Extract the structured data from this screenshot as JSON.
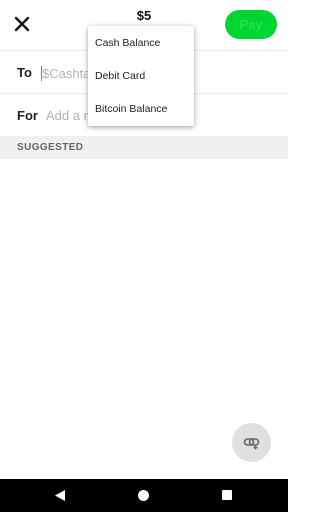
{
  "header": {
    "amount": "$5",
    "pay_label": "Pay",
    "close_icon": "close-icon"
  },
  "form": {
    "to_label": "To",
    "to_placeholder": "$Cashtag, Phone, Email",
    "to_value": "",
    "for_label": "For",
    "for_placeholder": "Add a note",
    "for_value": ""
  },
  "funding_menu": {
    "items": [
      {
        "label": "Cash Balance"
      },
      {
        "label": "Debit Card"
      },
      {
        "label": "Bitcoin Balance"
      }
    ]
  },
  "suggested": {
    "header": "SUGGESTED"
  },
  "fab": {
    "icon": "link-share-icon"
  },
  "nav": {
    "back_icon": "back-triangle-icon",
    "home_icon": "home-circle-icon",
    "recents_icon": "recents-square-icon"
  },
  "colors": {
    "accent": "#00d632",
    "section_bg": "#f0f0f0",
    "fab_bg": "#e0e0e0",
    "navbar_bg": "#000000",
    "placeholder": "#b3b3b3"
  }
}
